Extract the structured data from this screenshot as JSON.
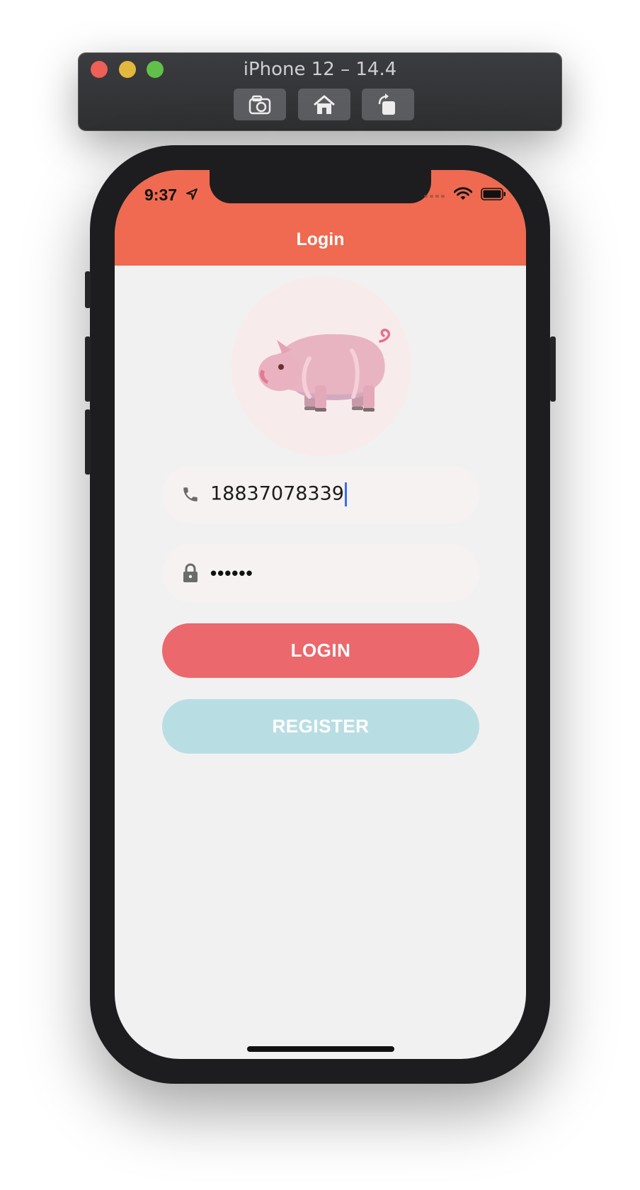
{
  "simulator": {
    "title": "iPhone 12 – 14.4",
    "toolbar": [
      {
        "icon": "camera-icon"
      },
      {
        "icon": "home-icon"
      },
      {
        "icon": "rotate-icon"
      }
    ]
  },
  "status_bar": {
    "time": "9:37",
    "icons": [
      "location-arrow-icon",
      "signal-icon",
      "wifi-icon",
      "battery-icon"
    ]
  },
  "nav": {
    "title": "Login"
  },
  "form": {
    "phone_value": "18837078339",
    "password_mask": "••••••",
    "phone_icon": "phone-icon",
    "lock_icon": "lock-icon"
  },
  "buttons": {
    "login_label": "LOGIN",
    "register_label": "REGISTER"
  },
  "colors": {
    "navbar": "#ef6a50",
    "login_button": "#eb686c",
    "register_button": "#b8dee4",
    "background": "#f2f1f1",
    "caret": "#3a6df0"
  }
}
